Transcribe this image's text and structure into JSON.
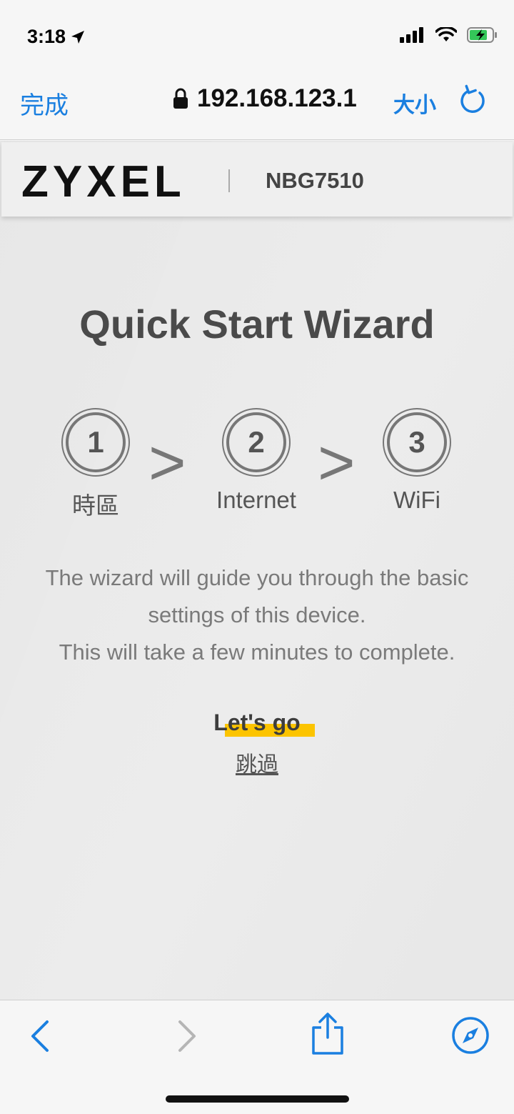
{
  "status_bar": {
    "time": "3:18"
  },
  "browser": {
    "done_label": "完成",
    "url": "192.168.123.1",
    "text_size_label": "大小"
  },
  "site": {
    "logo": "ZYXEL",
    "model": "NBG7510"
  },
  "wizard": {
    "title": "Quick Start Wizard",
    "steps": [
      {
        "number": "1",
        "label": "時區"
      },
      {
        "number": "2",
        "label": "Internet"
      },
      {
        "number": "3",
        "label": "WiFi"
      }
    ],
    "arrow": ">",
    "description_line1": "The wizard will guide you through the basic",
    "description_line2": "settings of this device.",
    "description_line3": "This will take a few minutes to complete.",
    "start_label": "Let's go",
    "skip_label": "跳過"
  },
  "colors": {
    "accent": "#1a7fe0",
    "highlight": "#fcc400"
  }
}
